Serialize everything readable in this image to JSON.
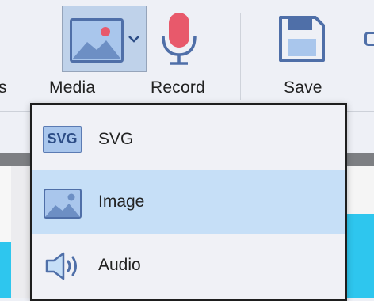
{
  "toolbar": {
    "partial_label": "s",
    "media_label": "Media",
    "record_label": "Record",
    "save_label": "Save"
  },
  "menu": {
    "items": [
      {
        "label": "SVG",
        "icon": "svg-badge-icon",
        "badge_text": "SVG",
        "selected": false
      },
      {
        "label": "Image",
        "icon": "image-icon",
        "selected": true
      },
      {
        "label": "Audio",
        "icon": "speaker-icon",
        "selected": false
      }
    ]
  },
  "colors": {
    "toolbar_bg": "#eef0f6",
    "selected_item_bg": "#c6dff7",
    "microphone": "#e8596b",
    "icon_blue": "#4f6fa8",
    "canvas_cyan": "#2ec6ee"
  }
}
